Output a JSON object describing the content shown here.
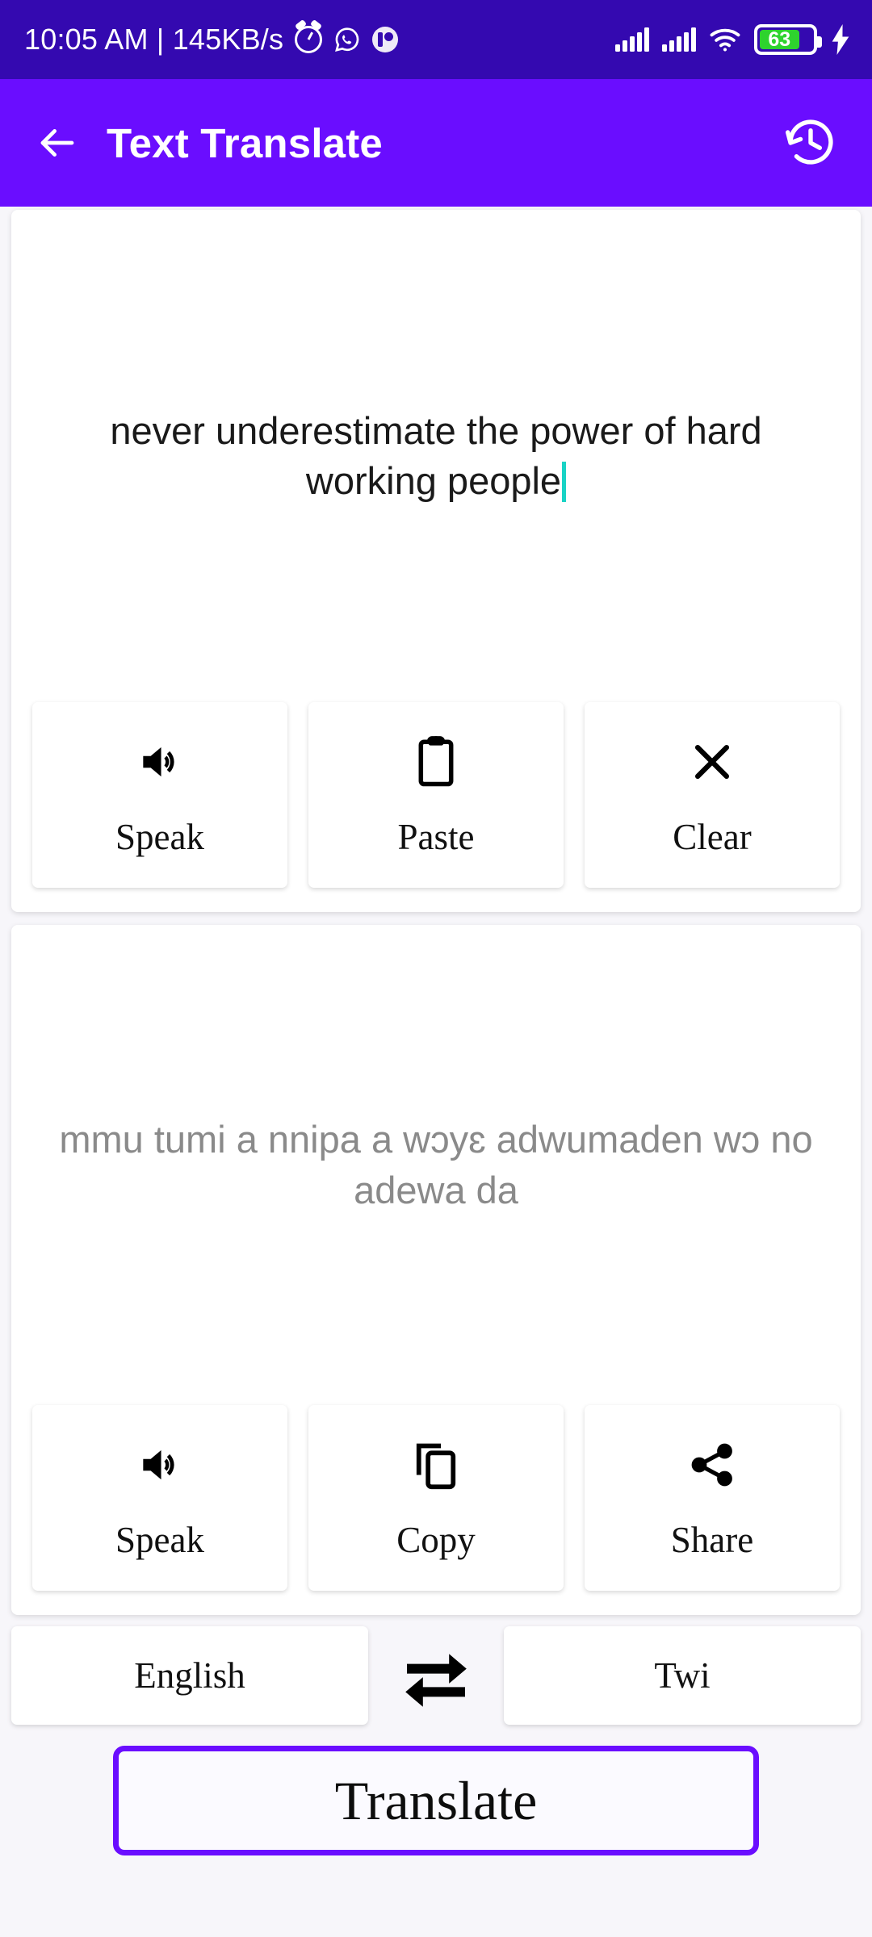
{
  "status_bar": {
    "time": "10:05 AM",
    "separator": "|",
    "network_speed": "145KB/s",
    "icons": [
      "alarm-icon",
      "whatsapp-icon",
      "app-notification-icon",
      "signal-bars-icon",
      "signal-bars-icon",
      "wifi-icon",
      "battery-icon",
      "charging-bolt-icon"
    ],
    "battery_percent": "63",
    "background_color": "#3409b0"
  },
  "app_bar": {
    "back_icon": "arrow-left-icon",
    "title": "Text Translate",
    "history_icon": "history-clock-icon",
    "background_color": "#6a0dff"
  },
  "source_panel": {
    "text": "never underestimate the power of hard working people",
    "has_cursor": true,
    "cursor_color": "#19d3c5",
    "buttons": [
      {
        "label": "Speak",
        "icon": "volume-up-icon"
      },
      {
        "label": "Paste",
        "icon": "clipboard-icon"
      },
      {
        "label": "Clear",
        "icon": "close-x-icon"
      }
    ]
  },
  "target_panel": {
    "text": "mmu tumi a nnipa a wɔyɛ adwumaden wɔ no adewa da",
    "text_color": "#8a8a8a",
    "buttons": [
      {
        "label": "Speak",
        "icon": "volume-up-icon"
      },
      {
        "label": "Copy",
        "icon": "copy-icon"
      },
      {
        "label": "Share",
        "icon": "share-nodes-icon"
      }
    ]
  },
  "language_row": {
    "source_language": "English",
    "swap_icon": "swap-horizontal-arrows-icon",
    "target_language": "Twi"
  },
  "translate_button": {
    "label": "Translate",
    "border_color": "#6a0dff"
  }
}
